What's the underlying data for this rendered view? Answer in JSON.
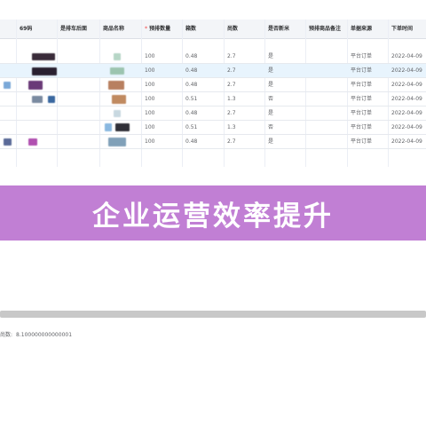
{
  "table": {
    "headers": [
      "69码",
      "是排车后面",
      "商品名称",
      "预排数量",
      "箱数",
      "尚数",
      "是否新米",
      "预排商品备注",
      "单据来源",
      "下单时间"
    ],
    "required_marker": "*",
    "rows": [
      {
        "qty": "100",
        "boxes": "0.48",
        "count": "2.7",
        "is_new": "是",
        "source": "平台订单",
        "date": "2022-04-09"
      },
      {
        "qty": "100",
        "boxes": "0.48",
        "count": "2.7",
        "is_new": "是",
        "source": "平台订单",
        "date": "2022-04-09"
      },
      {
        "qty": "100",
        "boxes": "0.48",
        "count": "2.7",
        "is_new": "是",
        "source": "平台订单",
        "date": "2022-04-09"
      },
      {
        "qty": "100",
        "boxes": "0.51",
        "count": "1.3",
        "is_new": "否",
        "source": "平台订单",
        "date": "2022-04-09"
      },
      {
        "qty": "100",
        "boxes": "0.48",
        "count": "2.7",
        "is_new": "是",
        "source": "平台订单",
        "date": "2022-04-09"
      },
      {
        "qty": "100",
        "boxes": "0.51",
        "count": "1.3",
        "is_new": "否",
        "source": "平台订单",
        "date": "2022-04-09"
      },
      {
        "qty": "100",
        "boxes": "0.48",
        "count": "2.7",
        "is_new": "是",
        "source": "平台订单",
        "date": "2022-04-09"
      }
    ]
  },
  "banner": {
    "title": "企业运营效率提升"
  },
  "footer": {
    "label": "尚数:",
    "value": "8.100000000000001"
  },
  "colors": {
    "banner_bg": "#c17fd4",
    "selected_row": "#e8f4fd"
  }
}
